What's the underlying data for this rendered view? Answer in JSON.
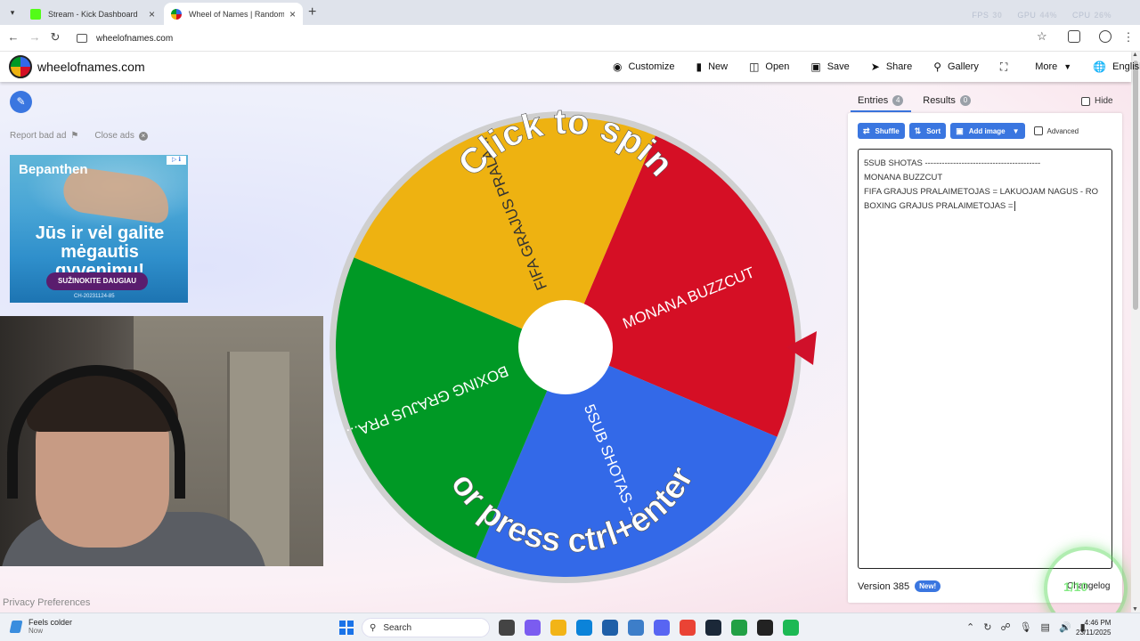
{
  "browser": {
    "tabs": [
      {
        "title": "Stream - Kick Dashboard",
        "favicon_color": "#53fc18",
        "active": false
      },
      {
        "title": "Wheel of Names | Random nam",
        "favicon_color": "#d50f25",
        "active": true
      }
    ],
    "new_tab": "+",
    "url": "wheelofnames.com",
    "overlay_stats": {
      "fps_label": "FPS",
      "fps": "30",
      "gpu_label": "GPU",
      "gpu": "44%",
      "cpu_label": "CPU",
      "cpu": "26%"
    }
  },
  "site": {
    "logo_text": "wheelofnames.com",
    "menu": [
      {
        "label": "Customize",
        "icon": "palette-icon"
      },
      {
        "label": "New",
        "icon": "file-icon"
      },
      {
        "label": "Open",
        "icon": "folder-open-icon"
      },
      {
        "label": "Save",
        "icon": "save-icon"
      },
      {
        "label": "Share",
        "icon": "share-icon"
      },
      {
        "label": "Gallery",
        "icon": "search-icon"
      },
      {
        "label": "",
        "icon": "fullscreen-icon"
      },
      {
        "label": "More",
        "icon": "chevron-down-icon"
      },
      {
        "label": "English",
        "icon": "globe-icon"
      }
    ]
  },
  "left": {
    "report_bad_ad": "Report bad ad",
    "close_ads": "Close ads",
    "ad": {
      "brand": "Bepanthen",
      "tagline": "Jūs ir vėl galite mėgautis gyvenimu!",
      "cta": "SUŽINOKITE DAUGIAU",
      "code": "CH-20231124-85"
    },
    "privacy": "Privacy Preferences"
  },
  "wheel": {
    "segments": [
      {
        "label": "MONANA BUZZCUT",
        "color": "#d50f25"
      },
      {
        "label": "5SUB SHOTAS -----",
        "color": "#3369e8"
      },
      {
        "label": "BOXING GRAJUS PRA...",
        "color": "#009925"
      },
      {
        "label": "FIFA GRAJUS PRALA...",
        "color": "#eeb211"
      }
    ],
    "prompt_top": "Click to spin",
    "prompt_bottom": "or press ctrl+enter"
  },
  "panel": {
    "entries_tab": "Entries",
    "entries_count": "4",
    "results_tab": "Results",
    "results_count": "0",
    "hide_label": "Hide",
    "shuffle": "Shuffle",
    "sort": "Sort",
    "add_image": "Add image",
    "advanced": "Advanced",
    "entries": [
      "5SUB SHOTAS -----------------------------------------",
      "MONANA BUZZCUT",
      "FIFA GRAJUS PRALAIMETOJAS = LAKUOJAM NAGUS - RO",
      "BOXING GRAJUS PRALAIMETOJAS ="
    ],
    "version": "Version 385",
    "new_badge": "New!",
    "changelog": "Changelog",
    "ring_text": "1/10"
  },
  "taskbar": {
    "weather_title": "Feels colder",
    "weather_sub": "Now",
    "search": "Search",
    "time": "4:46 PM",
    "date": "23/11/2025",
    "app_colors": [
      "#444444",
      "#7b5cf0",
      "#f2b417",
      "#0b83d9",
      "#1f5fa8",
      "#3d7ec9",
      "#5865f2",
      "#ea4335",
      "#1b2838",
      "#22a045",
      "#222222",
      "#1db954"
    ]
  }
}
